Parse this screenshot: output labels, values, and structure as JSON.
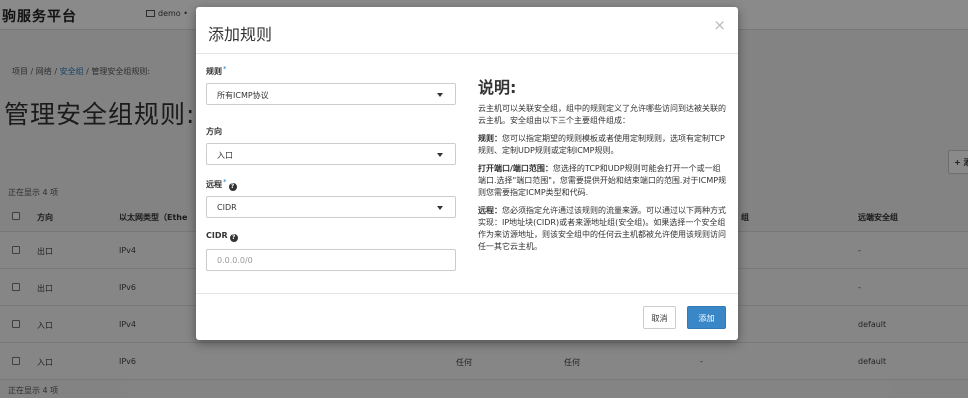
{
  "app": {
    "brand": "驹服务平台",
    "project": "demo •"
  },
  "breadcrumb": {
    "items": [
      "项目",
      "网络",
      "安全组",
      "管理安全组规则:"
    ],
    "separator": "/"
  },
  "page": {
    "title": "管理安全组规则:",
    "add_button_fragment": "+ 添"
  },
  "table": {
    "count_top": "正在显示 4 项",
    "count_bottom": "正在显示 4 项",
    "headers": {
      "direction": "方向",
      "ethertype": "以太网类型（Ethe",
      "remote_group_fragment": "组",
      "remote_sg": "远端安全组"
    },
    "rows": [
      {
        "direction": "出口",
        "ethertype": "IPv4",
        "port": "",
        "remote": "",
        "dash": "",
        "group": "-"
      },
      {
        "direction": "出口",
        "ethertype": "IPv6",
        "port": "",
        "remote": "",
        "dash": "",
        "group": "-"
      },
      {
        "direction": "入口",
        "ethertype": "IPv4",
        "port": "",
        "remote": "",
        "dash": "",
        "group": "default"
      },
      {
        "direction": "入口",
        "ethertype": "IPv6",
        "port": "任何",
        "remote": "任何",
        "dash": "-",
        "group": "default"
      }
    ]
  },
  "modal": {
    "title": "添加规则",
    "close": "×",
    "fields": {
      "rule": {
        "label": "规则",
        "required": "*",
        "value": "所有ICMP协议"
      },
      "direction": {
        "label": "方向",
        "value": "入口"
      },
      "remote": {
        "label": "远程",
        "required": "*",
        "help": "?",
        "value": "CIDR"
      },
      "cidr": {
        "label": "CIDR",
        "help": "?",
        "placeholder": "0.0.0.0/0"
      }
    },
    "description": {
      "title": "说明:",
      "intro": "云主机可以关联安全组，组中的规则定义了允许哪些访问到达被关联的云主机。安全组由以下三个主要组件组成：",
      "rule_term": "规则：",
      "rule_text": "您可以指定期望的规则模板或者使用定制规则，选项有定制TCP规则、定制UDP规则或定制ICMP规则。",
      "port_term": "打开端口/端口范围：",
      "port_text": "您选择的TCP和UDP规则可能会打开一个或一组端口.选择\"端口范围\"，您需要提供开始和结束端口的范围.对于ICMP规则您需要指定ICMP类型和代码.",
      "remote_term": "远程：",
      "remote_text": "您必须指定允许通过该规则的流量来源。可以通过以下两种方式实现：IP地址块(CIDR)或者来源地址组(安全组)。如果选择一个安全组作为来访源地址，则该安全组中的任何云主机都被允许使用该规则访问任一其它云主机。"
    },
    "buttons": {
      "cancel": "取消",
      "add": "添加"
    }
  },
  "colors": {
    "accent": "#3a87c8",
    "overlay": "rgba(0,0,0,0.46)"
  }
}
